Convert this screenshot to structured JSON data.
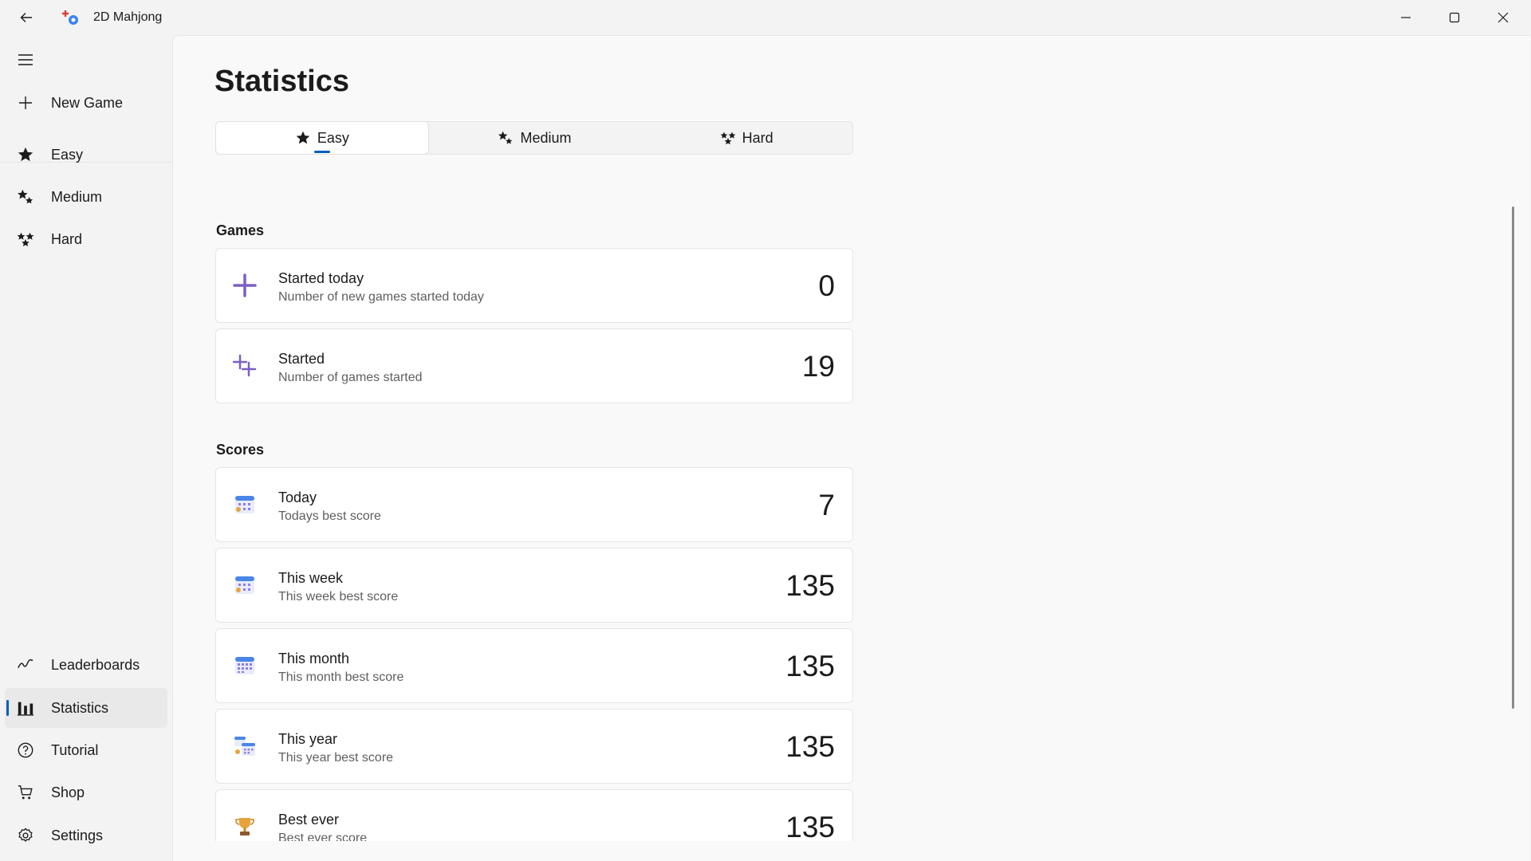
{
  "app": {
    "title": "2D Mahjong"
  },
  "sidebar": {
    "new_game": "New Game",
    "items": [
      {
        "label": "Easy",
        "icon": "star-icon"
      },
      {
        "label": "Medium",
        "icon": "stars-medium-icon"
      },
      {
        "label": "Hard",
        "icon": "stars-hard-icon"
      }
    ],
    "bottom_items": [
      {
        "label": "Leaderboards",
        "icon": "leaderboards-icon"
      },
      {
        "label": "Statistics",
        "icon": "statistics-icon",
        "selected": true
      },
      {
        "label": "Tutorial",
        "icon": "help-icon"
      },
      {
        "label": "Shop",
        "icon": "cart-icon"
      },
      {
        "label": "Settings",
        "icon": "gear-icon"
      }
    ]
  },
  "page": {
    "title": "Statistics",
    "tabs": [
      {
        "label": "Easy",
        "selected": true
      },
      {
        "label": "Medium"
      },
      {
        "label": "Hard"
      }
    ],
    "sections": {
      "games": {
        "title": "Games",
        "cards": [
          {
            "title": "Started today",
            "subtitle": "Number of new games started today",
            "value": "0",
            "icon": "plus-icon"
          },
          {
            "title": "Started",
            "subtitle": "Number of games started",
            "value": "19",
            "icon": "plus-multiple-icon"
          }
        ]
      },
      "scores": {
        "title": "Scores",
        "cards": [
          {
            "title": "Today",
            "subtitle": "Todays best score",
            "value": "7",
            "icon": "calendar-day-icon"
          },
          {
            "title": "This week",
            "subtitle": "This week best score",
            "value": "135",
            "icon": "calendar-week-icon"
          },
          {
            "title": "This month",
            "subtitle": "This month best score",
            "value": "135",
            "icon": "calendar-month-icon"
          },
          {
            "title": "This year",
            "subtitle": "This year best score",
            "value": "135",
            "icon": "calendar-year-icon"
          },
          {
            "title": "Best ever",
            "subtitle": "Best ever score",
            "value": "135",
            "icon": "trophy-icon"
          }
        ]
      }
    }
  },
  "colors": {
    "accent": "#005fb8",
    "purple": "#7b5fc4",
    "calendar_blue": "#4a86e8"
  }
}
